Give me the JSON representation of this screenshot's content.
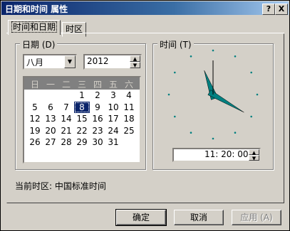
{
  "title": "日期和时间 属性",
  "titlebar_buttons": {
    "help": "?",
    "close": "X"
  },
  "tabs": [
    {
      "label": "时间和日期",
      "active": true
    },
    {
      "label": "时区",
      "active": false
    }
  ],
  "date_group": {
    "label": "日期 (D)",
    "month": "八月",
    "year": "2012",
    "weekdays": [
      "日",
      "一",
      "二",
      "三",
      "四",
      "五",
      "六"
    ],
    "weeks": [
      [
        "",
        "",
        "",
        "1",
        "2",
        "3",
        "4"
      ],
      [
        "5",
        "6",
        "7",
        "8",
        "9",
        "10",
        "11"
      ],
      [
        "12",
        "13",
        "14",
        "15",
        "16",
        "17",
        "18"
      ],
      [
        "19",
        "20",
        "21",
        "22",
        "23",
        "24",
        "25"
      ],
      [
        "26",
        "27",
        "28",
        "29",
        "30",
        "31",
        ""
      ]
    ],
    "selected_day": "8"
  },
  "time_group": {
    "label": "时间 (T)",
    "time": "11: 20: 00",
    "hour": 11,
    "minute": 20,
    "second": 0
  },
  "current_timezone": "当前时区: 中国标准时间",
  "buttons": {
    "ok": "确定",
    "cancel": "取消",
    "apply": "应用 (A)"
  },
  "colors": {
    "title_bar": "#0a246a",
    "selection": "#0a246a",
    "clock_hands": "#008080",
    "background": "#d4d0c8"
  }
}
